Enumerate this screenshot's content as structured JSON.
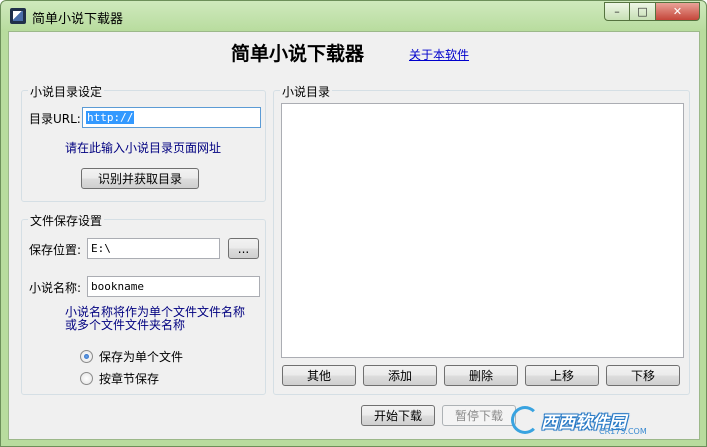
{
  "window": {
    "title": "简单小说下载器",
    "caption": {
      "minimize": "–",
      "maximize": "□",
      "close": "✕"
    }
  },
  "header": {
    "title": "简单小说下载器",
    "about_link": "关于本软件"
  },
  "catalog_settings": {
    "group_label": "小说目录设定",
    "url_label": "目录URL:",
    "url_value": "http://",
    "hint": "请在此输入小说目录页面网址",
    "fetch_button": "识别并获取目录"
  },
  "save_settings": {
    "group_label": "文件保存设置",
    "location_label": "保存位置:",
    "location_value": "E:\\",
    "browse_button": "...",
    "name_label": "小说名称:",
    "name_value": "bookname",
    "hint_line1": "小说名称将作为单个文件文件名称",
    "hint_line2": "或多个文件文件夹名称",
    "options": [
      {
        "label": "保存为单个文件",
        "checked": true
      },
      {
        "label": "按章节保存",
        "checked": false
      }
    ]
  },
  "catalog_list": {
    "group_label": "小说目录",
    "buttons": {
      "other": "其他",
      "add": "添加",
      "delete": "删除",
      "move_up": "上移",
      "move_down": "下移"
    }
  },
  "footer": {
    "start_button": "开始下载",
    "pause_button": "暂停下载"
  },
  "watermark": {
    "text": "西西软件园",
    "sub": "CR173.COM"
  }
}
